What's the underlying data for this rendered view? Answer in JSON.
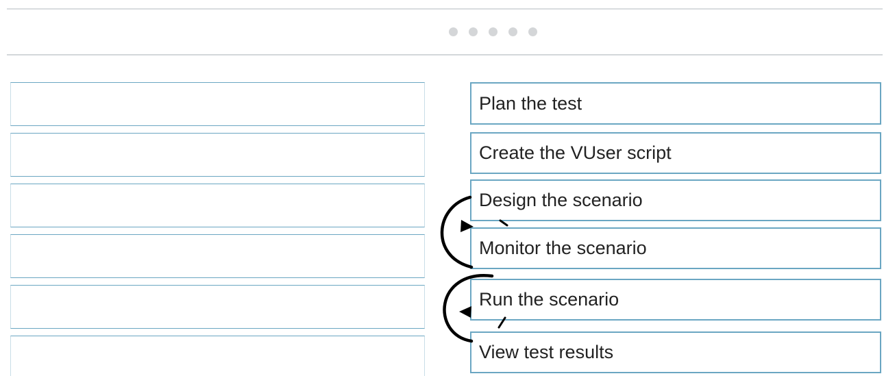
{
  "pager": {
    "dots": [
      "",
      "",
      "",
      "",
      ""
    ]
  },
  "answer_area": {
    "slots": [
      "",
      "",
      "",
      "",
      "",
      ""
    ]
  },
  "actions": {
    "items": [
      {
        "label": "Plan the test"
      },
      {
        "label": "Create the VUser script"
      },
      {
        "label": "Design the scenario"
      },
      {
        "label": "Monitor the scenario"
      },
      {
        "label": "Run the scenario"
      },
      {
        "label": "View test results"
      }
    ]
  },
  "icons": {
    "reorder_up": "reorder-up-arrow-icon",
    "reorder_down": "reorder-down-arrow-icon"
  },
  "colors": {
    "box_border": "#6aa6c2",
    "rule": "#d3d7da",
    "dot": "#d4d6d8",
    "text": "#222222",
    "arrow": "#000000"
  }
}
